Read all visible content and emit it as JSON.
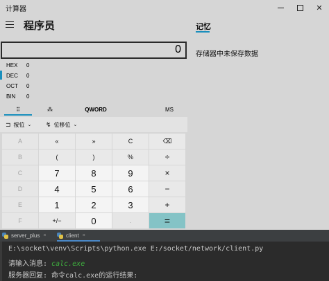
{
  "window": {
    "title": "计算器",
    "minimize_glyph": "",
    "close_glyph": "✕"
  },
  "header": {
    "mode_title": "程序员"
  },
  "display": {
    "value": "0"
  },
  "radix": [
    {
      "label": "HEX",
      "value": "0"
    },
    {
      "label": "DEC",
      "value": "0"
    },
    {
      "label": "OCT",
      "value": "0"
    },
    {
      "label": "BIN",
      "value": "0"
    }
  ],
  "selected_radix": "DEC",
  "tabs": {
    "keypad_icon": "⠿",
    "bitflip_icon": "⁂",
    "word_size": "QWORD",
    "memory_store": "MS"
  },
  "operators": {
    "bitwise": {
      "icon": "⊐",
      "label": "按位",
      "chevron": "⌄"
    },
    "bitshift": {
      "icon": "↯",
      "label": "位移位",
      "chevron": "⌄"
    }
  },
  "keys": [
    [
      "A",
      "«",
      "»",
      "C",
      "⌫"
    ],
    [
      "B",
      "(",
      ")",
      "%",
      "÷"
    ],
    [
      "C",
      "7",
      "8",
      "9",
      "×"
    ],
    [
      "D",
      "4",
      "5",
      "6",
      "−"
    ],
    [
      "E",
      "1",
      "2",
      "3",
      "+"
    ],
    [
      "F",
      "+/−",
      "0",
      ".",
      "="
    ]
  ],
  "memory": {
    "tab_label": "记忆",
    "empty_message": "存储器中未保存数据"
  },
  "ide": {
    "tabs": [
      {
        "label": "server_plus",
        "close": "×"
      },
      {
        "label": "client",
        "close": "×"
      }
    ],
    "console": {
      "command_line": "E:\\socket\\venv\\Scripts\\python.exe E:/socket/network/client.py",
      "prompt": "请输入消息: ",
      "input": "calc.exe",
      "reply": "服务器回复: 命令calc.exe的运行结果:"
    }
  },
  "colors": {
    "accent": "#1a8fbd",
    "equals_button": "#84c3c6",
    "console_input": "#3eae3e"
  }
}
